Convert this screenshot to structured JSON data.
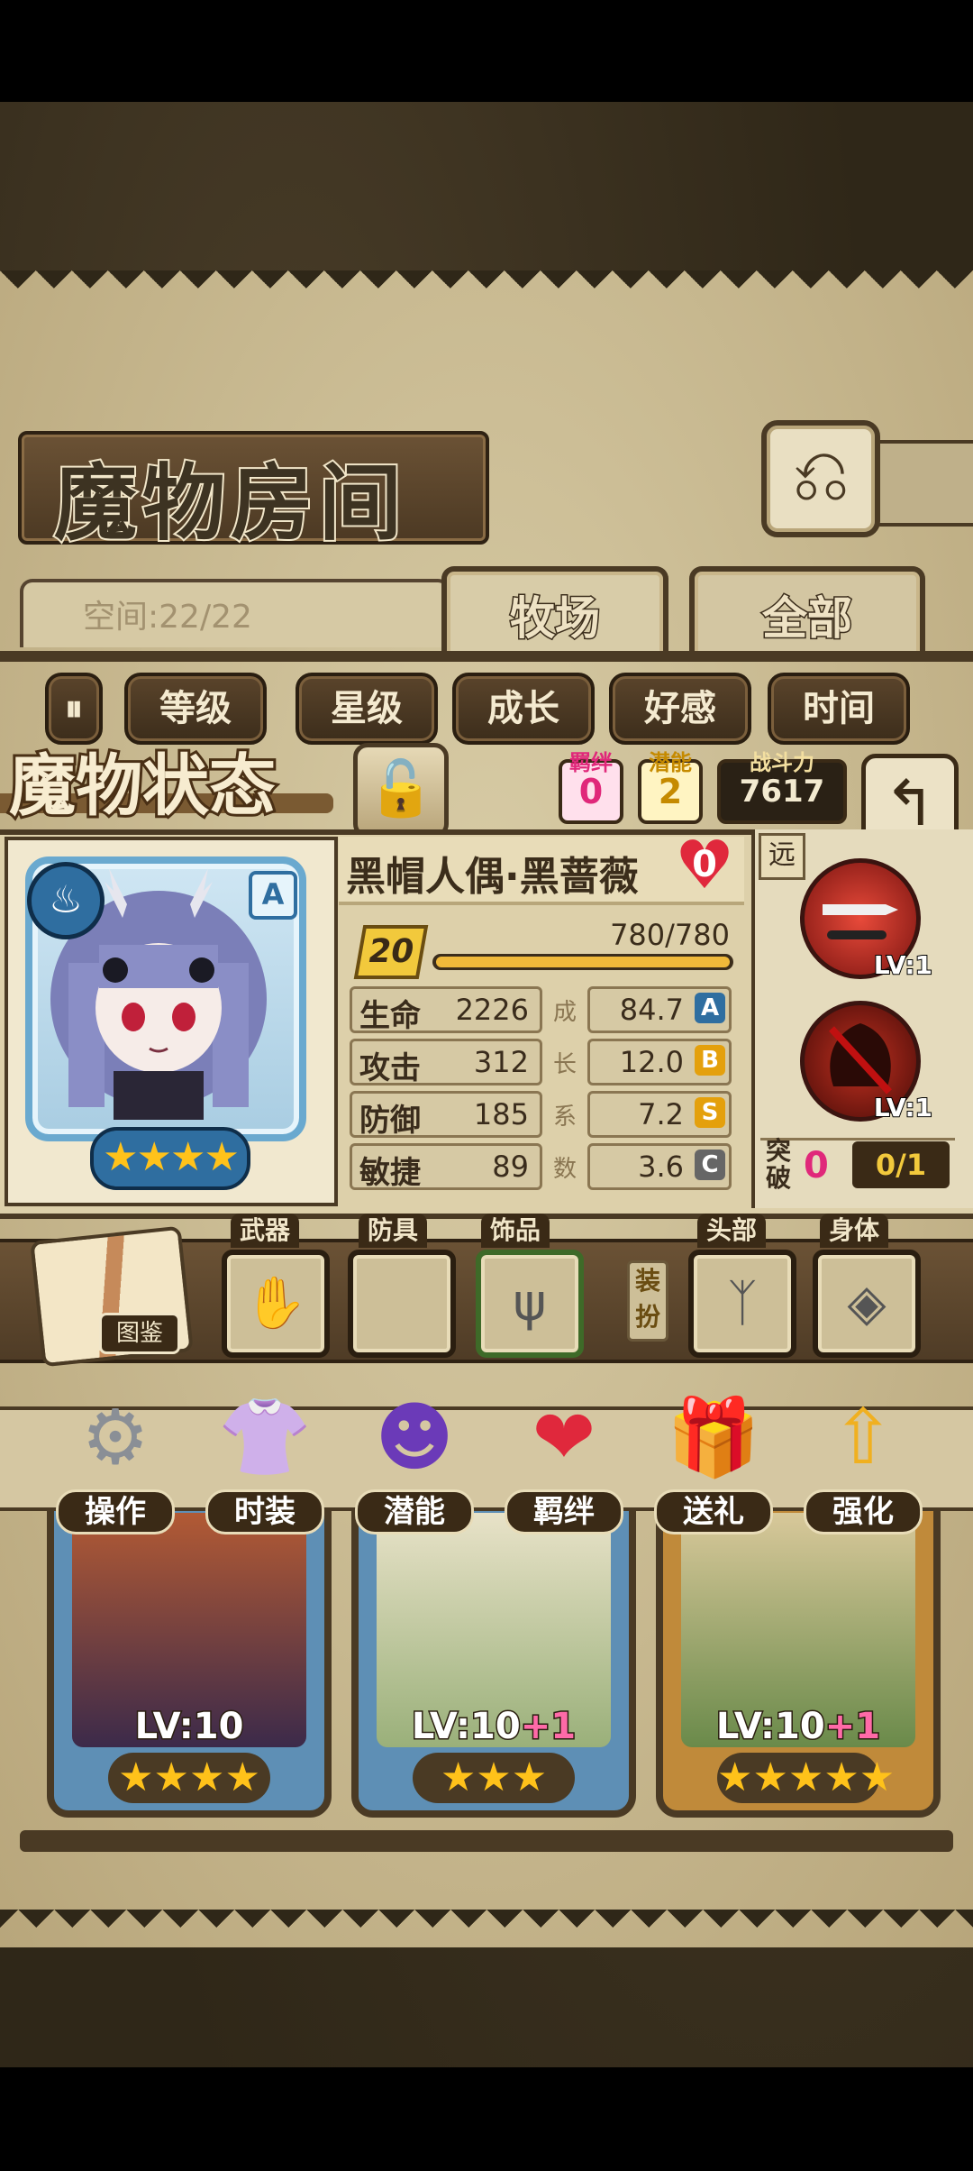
{
  "room": {
    "title": "魔物房间",
    "back_icon": "return-arrow-icon",
    "space_text": "空间:22/22",
    "tabs": [
      {
        "label": "牧场"
      },
      {
        "label": "全部"
      }
    ]
  },
  "sort": {
    "toggle_icon": "pause-sort-icon",
    "buttons": [
      "等级",
      "星级",
      "成长",
      "好感",
      "时间"
    ]
  },
  "status": {
    "title": "魔物状态",
    "lock_icon": "padlock-icon",
    "bond": {
      "label": "羁绊",
      "value": "0"
    },
    "potential": {
      "label": "潜能",
      "value": "2"
    },
    "power": {
      "label": "战斗力",
      "value": "7617"
    },
    "return_icon": "return-arrow-icon"
  },
  "monster": {
    "name": "黑帽人偶·黑蔷薇",
    "heart_value": "0",
    "rank": "A",
    "element_icon": "water-element-icon",
    "stars": "★★★★",
    "level": "20",
    "exp_text": "780/780",
    "exp_ratio": 1.0,
    "stats": [
      {
        "name": "生命",
        "value": "2226",
        "growth": "84.7",
        "grade": "A"
      },
      {
        "name": "攻击",
        "value": "312",
        "growth": "12.0",
        "grade": "B"
      },
      {
        "name": "防御",
        "value": "185",
        "growth": "7.2",
        "grade": "S"
      },
      {
        "name": "敏捷",
        "value": "89",
        "growth": "3.6",
        "grade": "C"
      }
    ],
    "growth_label": [
      "成",
      "长",
      "系",
      "数"
    ]
  },
  "skills": {
    "range": "远",
    "items": [
      {
        "icon": "blades-skill-icon",
        "level": "LV:1"
      },
      {
        "icon": "dark-tree-skill-icon",
        "level": "LV:1"
      }
    ],
    "breakthrough_label": "突破",
    "breakthrough_value": "0",
    "breakthrough_count": "0/1"
  },
  "equipment": {
    "book_label": "图鉴",
    "slots": [
      {
        "label": "武器",
        "icon": "weapon-glove-icon",
        "glyph": "✋"
      },
      {
        "label": "防具",
        "icon": "empty-slot-icon",
        "glyph": ""
      },
      {
        "label": "饰品",
        "icon": "fork-accessory-icon",
        "glyph": "ψ"
      }
    ],
    "dress_label": "装扮",
    "dress_slots": [
      {
        "label": "头部",
        "icon": "antler-head-icon",
        "glyph": "ᛉ"
      },
      {
        "label": "身体",
        "icon": "body-crest-icon",
        "glyph": "◈"
      }
    ]
  },
  "actions": [
    {
      "label": "操作",
      "icon": "gear-icon",
      "glyph": "⚙",
      "color": "#8a8f96"
    },
    {
      "label": "时装",
      "icon": "outfit-icon",
      "glyph": "👚",
      "color": "#f08ac8"
    },
    {
      "label": "潜能",
      "icon": "demon-potential-icon",
      "glyph": "☻",
      "color": "#6b3ab8"
    },
    {
      "label": "羁绊",
      "icon": "hearts-bond-icon",
      "glyph": "❤",
      "color": "#e0283c"
    },
    {
      "label": "送礼",
      "icon": "gift-icon",
      "glyph": "🎁",
      "color": "#e8c22a"
    },
    {
      "label": "强化",
      "icon": "upgrade-arrows-icon",
      "glyph": "⇧",
      "color": "#f0b020"
    }
  ],
  "cards": [
    {
      "level": "LV:10",
      "plus": "",
      "stars": "★★★★"
    },
    {
      "level": "LV:10",
      "plus": "+1",
      "stars": "★★★"
    },
    {
      "level": "LV:10",
      "plus": "+1",
      "stars": "★★★★★"
    }
  ],
  "colors": {
    "parchment": "#cdbf98",
    "wood": "#4a3a24",
    "bond": "#e0287a",
    "potential": "#c58a00",
    "frame_blue": "#6aa9cf"
  }
}
